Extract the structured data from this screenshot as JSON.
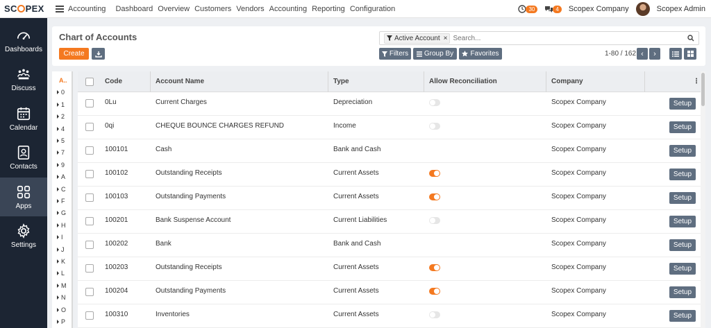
{
  "brand": {
    "logo_text_pre": "SC",
    "logo_text_post": "PEX"
  },
  "topbar": {
    "app_title": "Accounting",
    "nav": [
      "Dashboard",
      "Overview",
      "Customers",
      "Vendors",
      "Accounting",
      "Reporting",
      "Configuration"
    ],
    "activity_count": "30",
    "message_count": "4",
    "company": "Scopex Company",
    "user": "Scopex Admin"
  },
  "sidebar": {
    "items": [
      {
        "label": "Dashboards",
        "icon": "gauge-icon"
      },
      {
        "label": "Discuss",
        "icon": "discuss-icon"
      },
      {
        "label": "Calendar",
        "icon": "calendar-icon"
      },
      {
        "label": "Contacts",
        "icon": "contacts-icon"
      },
      {
        "label": "Apps",
        "icon": "apps-grid-icon",
        "active": true
      },
      {
        "label": "Settings",
        "icon": "gear-icon"
      }
    ]
  },
  "control_panel": {
    "title": "Chart of Accounts",
    "create_label": "Create",
    "search": {
      "facet": "Active Account",
      "placeholder": "Search..."
    },
    "filters_label": "Filters",
    "groupby_label": "Group By",
    "favorites_label": "Favorites",
    "pager": "1-80 / 162"
  },
  "alphabet": [
    "A..",
    "0",
    "1",
    "2",
    "4",
    "5",
    "7",
    "9",
    "A",
    "C",
    "F",
    "G",
    "H",
    "I",
    "J",
    "K",
    "L",
    "M",
    "N",
    "O",
    "P"
  ],
  "table": {
    "headers": {
      "code": "Code",
      "name": "Account Name",
      "type": "Type",
      "reconcile": "Allow Reconciliation",
      "company": "Company"
    },
    "setup_label": "Setup",
    "rows": [
      {
        "code": "0Lu",
        "name": "Current Charges",
        "type": "Depreciation",
        "reconcile": "off",
        "company": "Scopex Company"
      },
      {
        "code": "0qi",
        "name": "CHEQUE BOUNCE CHARGES REFUND",
        "type": "Income",
        "reconcile": "off",
        "company": "Scopex Company"
      },
      {
        "code": "100101",
        "name": "Cash",
        "type": "Bank and Cash",
        "reconcile": "none",
        "company": "Scopex Company"
      },
      {
        "code": "100102",
        "name": "Outstanding Receipts",
        "type": "Current Assets",
        "reconcile": "on",
        "company": "Scopex Company"
      },
      {
        "code": "100103",
        "name": "Outstanding Payments",
        "type": "Current Assets",
        "reconcile": "on",
        "company": "Scopex Company"
      },
      {
        "code": "100201",
        "name": "Bank Suspense Account",
        "type": "Current Liabilities",
        "reconcile": "off",
        "company": "Scopex Company"
      },
      {
        "code": "100202",
        "name": "Bank",
        "type": "Bank and Cash",
        "reconcile": "none",
        "company": "Scopex Company"
      },
      {
        "code": "100203",
        "name": "Outstanding Receipts",
        "type": "Current Assets",
        "reconcile": "on",
        "company": "Scopex Company"
      },
      {
        "code": "100204",
        "name": "Outstanding Payments",
        "type": "Current Assets",
        "reconcile": "on",
        "company": "Scopex Company"
      },
      {
        "code": "100310",
        "name": "Inventories",
        "type": "Current Assets",
        "reconcile": "off",
        "company": "Scopex Company"
      }
    ]
  },
  "colors": {
    "accent": "#f47920",
    "sidebar": "#1c2533",
    "button": "#5f6e80"
  }
}
